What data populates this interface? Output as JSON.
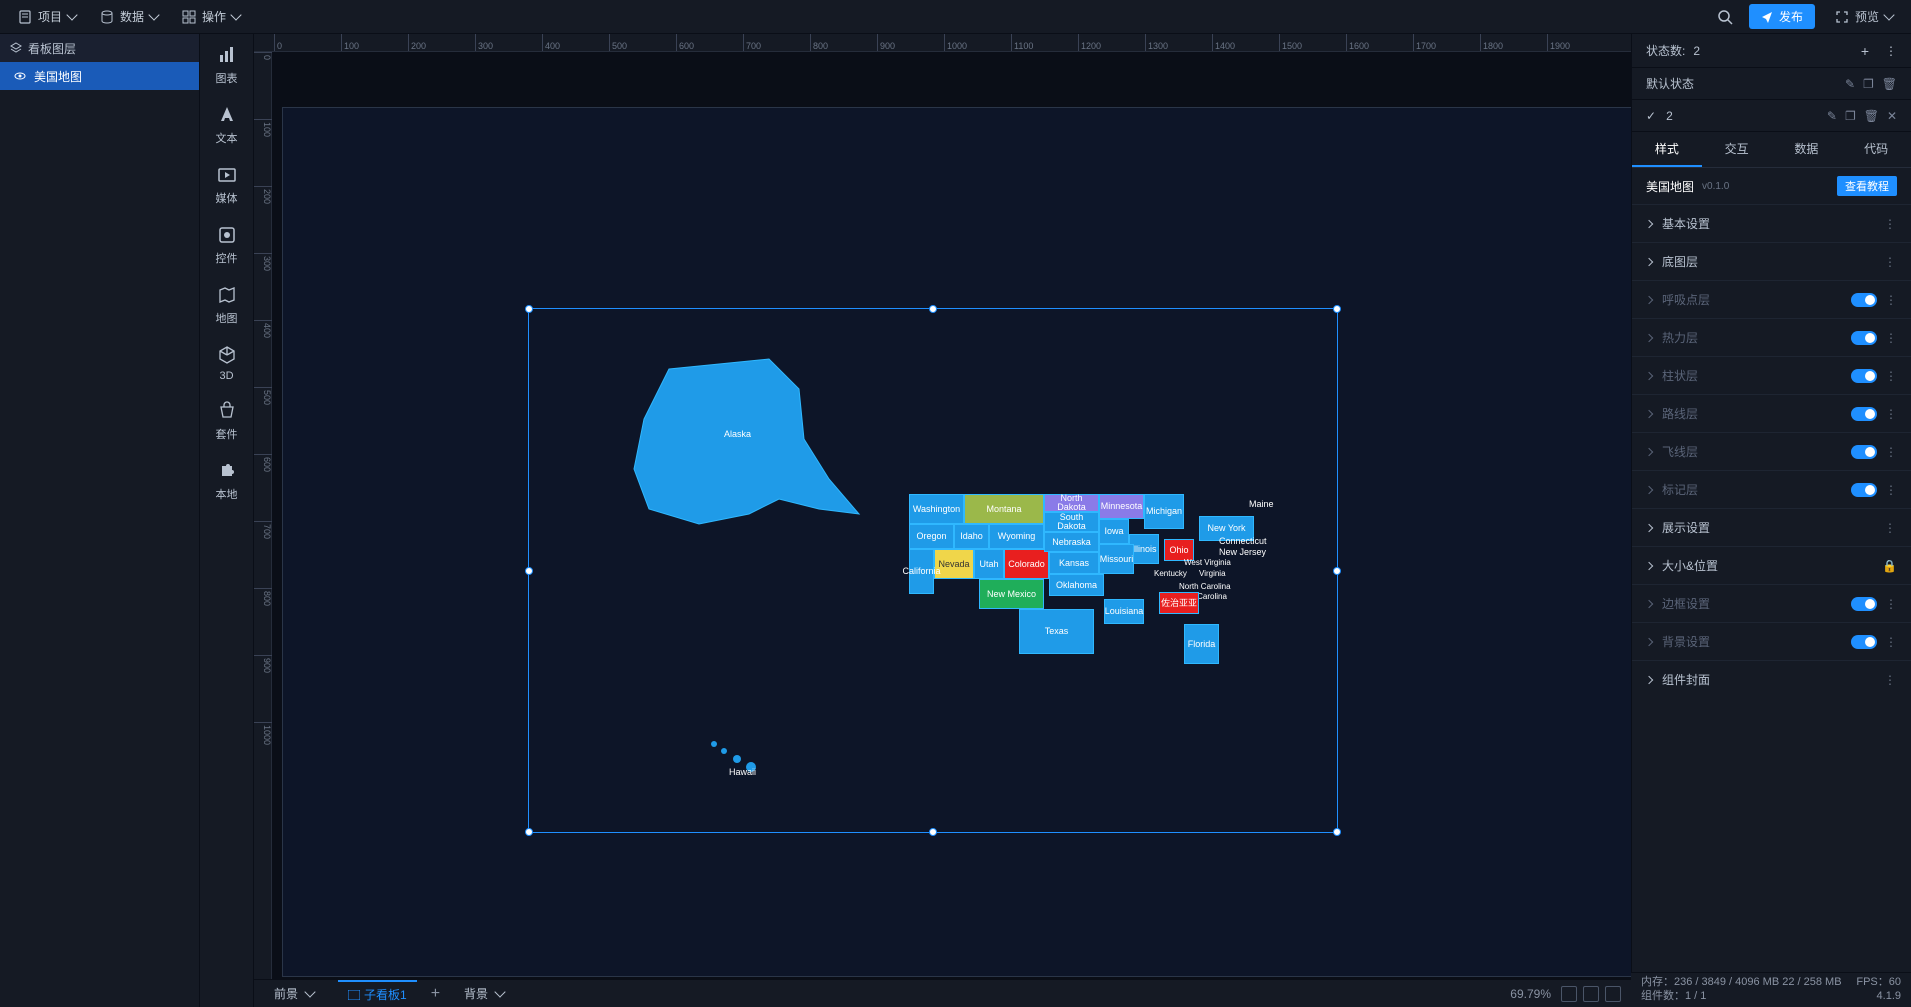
{
  "topbar": {
    "menu": [
      {
        "icon": "file",
        "label": "项目"
      },
      {
        "icon": "db",
        "label": "数据"
      },
      {
        "icon": "grid",
        "label": "操作"
      }
    ],
    "publish_label": "发布",
    "preview_label": "预览"
  },
  "layers": {
    "header": "看板图层",
    "items": [
      {
        "label": "美国地图"
      }
    ]
  },
  "component_bar": [
    {
      "label": "图表"
    },
    {
      "label": "文本"
    },
    {
      "label": "媒体"
    },
    {
      "label": "控件"
    },
    {
      "label": "地图"
    },
    {
      "label": "3D"
    },
    {
      "label": "套件"
    },
    {
      "label": "本地"
    }
  ],
  "canvas": {
    "bottom_tabs": [
      {
        "label": "前景",
        "active": false
      },
      {
        "label": "子看板1",
        "active": true
      }
    ],
    "bg_label": "背景",
    "zoom": "69.79%"
  },
  "map": {
    "alaska": "Alaska",
    "hawaii": "Hawaii",
    "states_lower48": [
      "Washington",
      "Montana",
      "North Dakota",
      "Minnesota",
      "Michigan",
      "Maine",
      "New York",
      "Oregon",
      "Idaho",
      "Wyoming",
      "South Dakota",
      "Iowa",
      "Illinois",
      "Ohio",
      "Connecticut",
      "New Jersey",
      "Nevada",
      "Utah",
      "Colorado",
      "Nebraska",
      "Kansas",
      "Missouri",
      "West Virginia",
      "Virginia",
      "Kentucky",
      "California",
      "New Mexico",
      "Oklahoma",
      "Texas",
      "Louisiana",
      "North Carolina",
      "South Carolina",
      "Florida"
    ],
    "highlight_label": "佐治亚亚",
    "colors": {
      "base": "#1f9be8",
      "montana": "#9bb84a",
      "colorado": "#e81f1f",
      "ohio": "#e81f1f",
      "nevada": "#f0d64a",
      "newmexico": "#1fae5a",
      "northdakota": "#8a7be8",
      "minnesota": "#8a7be8",
      "highlight": "#e81f1f"
    }
  },
  "prop": {
    "state_count_label": "状态数:",
    "state_count_value": "2",
    "default_state": "默认状态",
    "state_2": "2",
    "tabs": [
      "样式",
      "交互",
      "数据",
      "代码"
    ],
    "component_name": "美国地图",
    "component_version": "v0.1.0",
    "tutorial_btn": "查看教程",
    "sections": [
      {
        "label": "基本设置",
        "type": "more"
      },
      {
        "label": "底图层",
        "type": "more"
      },
      {
        "label": "呼吸点层",
        "type": "toggle",
        "on": true,
        "dim": true
      },
      {
        "label": "热力层",
        "type": "toggle",
        "on": true,
        "dim": true
      },
      {
        "label": "柱状层",
        "type": "toggle",
        "on": true,
        "dim": true
      },
      {
        "label": "路线层",
        "type": "toggle",
        "on": true,
        "dim": true
      },
      {
        "label": "飞线层",
        "type": "toggle",
        "on": true,
        "dim": true
      },
      {
        "label": "标记层",
        "type": "toggle",
        "on": true,
        "dim": true
      },
      {
        "label": "展示设置",
        "type": "more"
      },
      {
        "label": "大小&位置",
        "type": "lock"
      },
      {
        "label": "边框设置",
        "type": "toggle",
        "on": true,
        "dim": true
      },
      {
        "label": "背景设置",
        "type": "toggle",
        "on": true,
        "dim": true
      },
      {
        "label": "组件封面",
        "type": "more"
      }
    ]
  },
  "status": {
    "memory": "内存：236 / 3849 / 4096 MB  22 / 258 MB",
    "fps": "FPS：60",
    "components": "组件数：1 / 1",
    "version": "4.1.9"
  },
  "ruler_ticks_h": [
    0,
    100,
    200,
    300,
    400,
    500,
    600,
    700,
    800,
    900,
    1000,
    1100,
    1200,
    1300,
    1400,
    1500,
    1600,
    1700,
    1800,
    1900
  ],
  "ruler_ticks_v": [
    0,
    100,
    200,
    300,
    400,
    500,
    600,
    700,
    800,
    900,
    1000
  ]
}
